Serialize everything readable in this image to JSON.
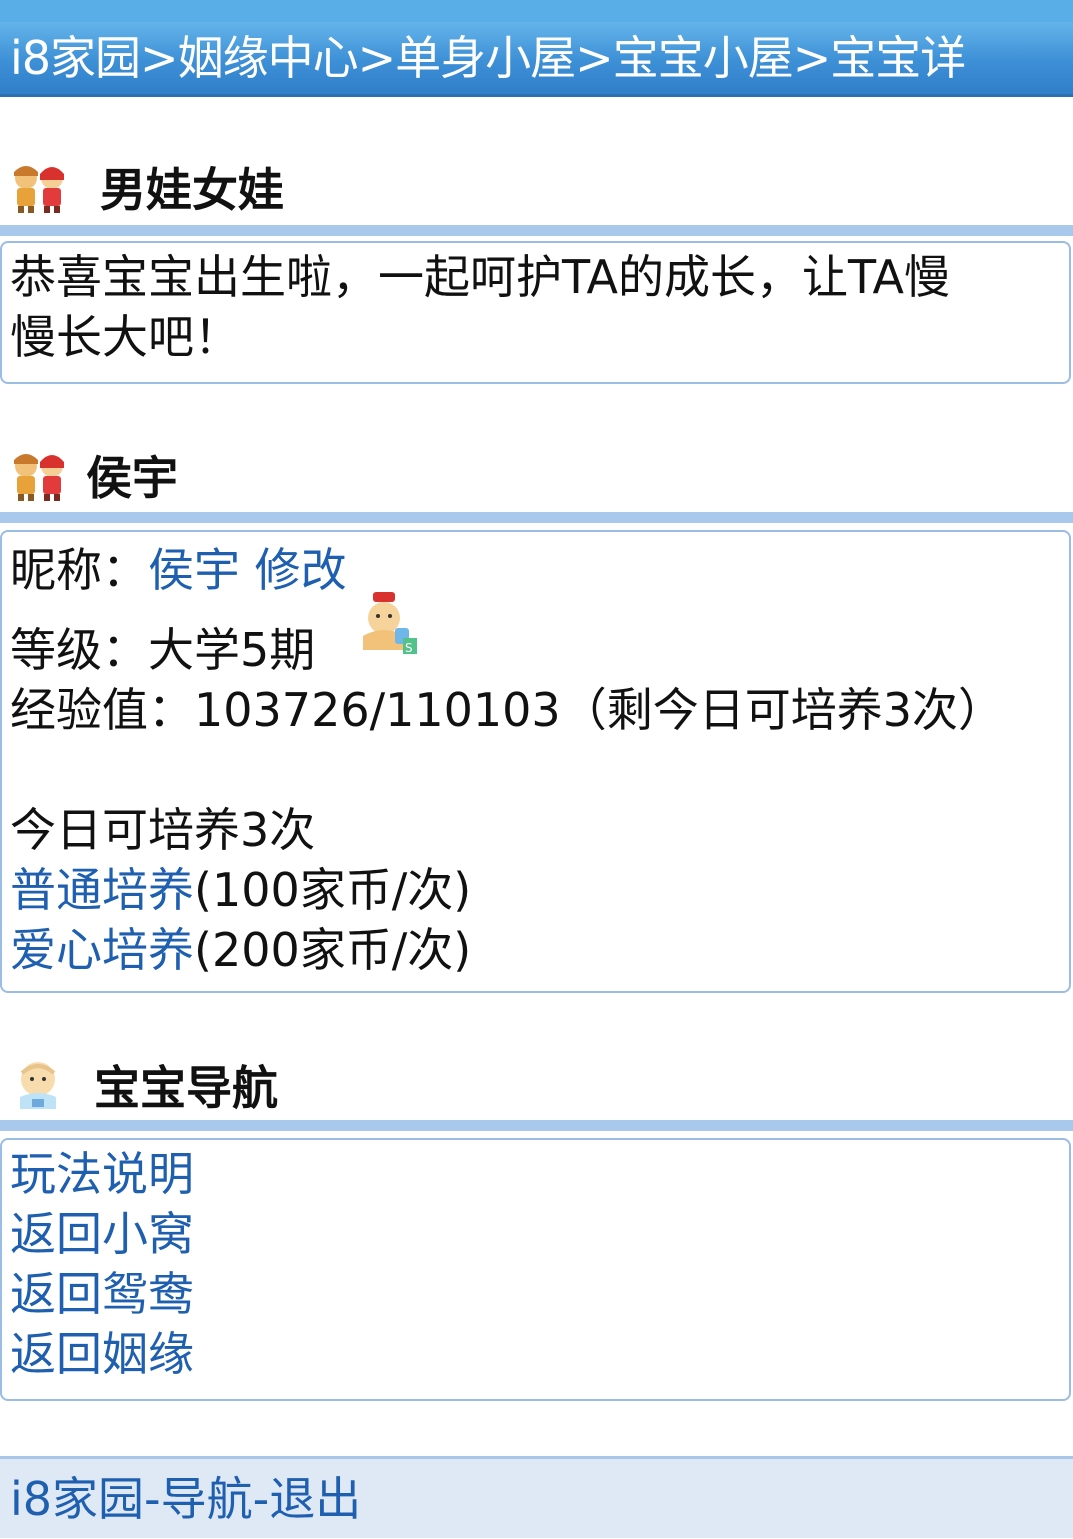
{
  "breadcrumb": {
    "items": [
      "i8家园",
      "姻缘中心",
      "单身小屋",
      "宝宝小屋",
      "宝宝详"
    ],
    "separator": ">"
  },
  "section1": {
    "title": "男娃女娃",
    "message": "恭喜宝宝出生啦，一起呵护TA的成长，让TA慢",
    "message_cont": "慢长大吧！"
  },
  "section2": {
    "title": "侯宇",
    "nickname_label": "昵称：",
    "nickname_value": "侯宇",
    "edit_link": "修改",
    "level_label": "等级：",
    "level_value": "大学5期",
    "exp_label": "经验值：",
    "exp_value": "103726/110103（剩今日可培养3次）",
    "today_text": "今日可培养3次",
    "normal_link": "普通培养",
    "normal_cost": "(100家币/次)",
    "love_link": "爱心培养",
    "love_cost": "(200家币/次)"
  },
  "section3": {
    "title": "宝宝导航",
    "links": [
      "玩法说明",
      "返回小窝",
      "返回鸳鸯",
      "返回姻缘"
    ]
  },
  "footer": {
    "home": "i8家园",
    "sep": "-",
    "nav": "导航",
    "exit": "退出"
  },
  "colors": {
    "header_bg": "#3d8fd6",
    "link": "#1f5fb0",
    "divider": "#a8c8ec",
    "border": "#9bbde4",
    "footer_bg": "#dfe9f6"
  },
  "icons": {
    "section_kids": "boy-girl-icon",
    "level_baby": "baby-level-icon",
    "nav_baby": "baby-icon"
  }
}
